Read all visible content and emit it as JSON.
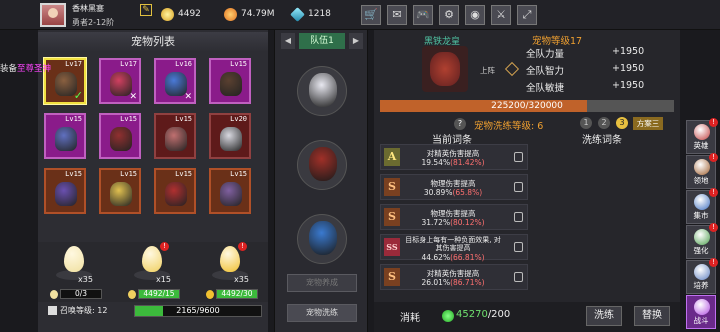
{
  "player": {
    "name": "香林黑塞",
    "rank": "勇者2-12阶"
  },
  "resources": {
    "gold": "4492",
    "food": "74.79M",
    "gem": "1218"
  },
  "toolbar": [
    {
      "name": "shop-icon",
      "glyph": "🛒"
    },
    {
      "name": "mail-icon",
      "glyph": "✉"
    },
    {
      "name": "gamepad-icon",
      "glyph": "🎮"
    },
    {
      "name": "settings-icon",
      "glyph": "⚙"
    },
    {
      "name": "color-wheel-icon",
      "glyph": "◉"
    },
    {
      "name": "sword-icon",
      "glyph": "⚔"
    },
    {
      "name": "expand-icon",
      "glyph": "⤢"
    }
  ],
  "pet_list": {
    "title": "宠物列表",
    "side_text_prefix": "装备",
    "side_text_highlight": "至尊圣神",
    "cards": [
      {
        "lv": "Lv17",
        "rarity": "orange",
        "color": "#8a6040",
        "selected": true,
        "mark": "check"
      },
      {
        "lv": "Lv17",
        "rarity": "purple",
        "color": "#d04060",
        "mark": "cross"
      },
      {
        "lv": "Lv16",
        "rarity": "purple",
        "color": "#4a7ad8",
        "mark": "cross"
      },
      {
        "lv": "Lv15",
        "rarity": "purple",
        "color": "#5a4030",
        "mark": ""
      },
      {
        "lv": "Lv15",
        "rarity": "purple",
        "color": "#6070c0",
        "mark": ""
      },
      {
        "lv": "Lv15",
        "rarity": "purple",
        "color": "#903030",
        "mark": ""
      },
      {
        "lv": "Lv15",
        "rarity": "red",
        "color": "#c07070",
        "mark": ""
      },
      {
        "lv": "Lv20",
        "rarity": "red",
        "color": "#d8d8e0",
        "mark": ""
      },
      {
        "lv": "Lv15",
        "rarity": "orange",
        "color": "#6a50b0",
        "mark": ""
      },
      {
        "lv": "Lv15",
        "rarity": "orange",
        "color": "#e0c050",
        "mark": ""
      },
      {
        "lv": "Lv15",
        "rarity": "orange",
        "color": "#b03030",
        "mark": ""
      },
      {
        "lv": "Lv15",
        "rarity": "orange",
        "color": "#8060a0",
        "mark": ""
      }
    ]
  },
  "eggs": [
    {
      "count": "x35",
      "progress": "0/3",
      "fill": 0.0,
      "color": "#f0e0a0"
    },
    {
      "count": "x15",
      "progress": "4492/15",
      "fill": 1.0,
      "color": "#f0d060"
    },
    {
      "count": "x35",
      "progress": "4492/30",
      "fill": 1.0,
      "color": "#f0c030"
    }
  ],
  "summon": {
    "label": "召唤等级: 12",
    "value": "2165/9600",
    "fill": 0.2255
  },
  "team": {
    "tab": "队伍1",
    "slots": [
      {
        "color": "#e8e8f0"
      },
      {
        "color": "#a03028"
      },
      {
        "color": "#3a7ad0"
      }
    ],
    "btn_equip": "宠物养成",
    "btn_wash": "宠物洗练"
  },
  "pet_info": {
    "name": "黑铁龙皇",
    "level": "宠物等级17",
    "onboard": "上阵",
    "buffs": [
      {
        "label": "全队力量",
        "value": "+1950"
      },
      {
        "label": "全队智力",
        "value": "+1950"
      },
      {
        "label": "全队敏捷",
        "value": "+1950"
      }
    ],
    "exp": "225200/320000",
    "exp_fill": 0.70375,
    "wash_level": "宠物洗练等级: 6",
    "plans": [
      "1",
      "2",
      "3"
    ],
    "active_plan": 2,
    "plan_name": "方案三",
    "col_current": "当前词条",
    "col_wash": "洗练词条",
    "affixes": [
      {
        "grade": "A",
        "cls": "a",
        "title": "对精英伤害提高",
        "value": "19.54%",
        "pct": "(81.42%)"
      },
      {
        "grade": "S",
        "cls": "s",
        "title": "物理伤害提高",
        "value": "30.89%",
        "pct": "(65.8%)"
      },
      {
        "grade": "S",
        "cls": "s",
        "title": "物理伤害提高",
        "value": "31.72%",
        "pct": "(80.12%)"
      },
      {
        "grade": "SS",
        "cls": "ss",
        "title": "目标身上每有一种负面效果, 对其伤害提高",
        "value": "44.62%",
        "pct": "(66.81%)",
        "multi": true
      },
      {
        "grade": "S",
        "cls": "s",
        "title": "对精英伤害提高",
        "value": "26.01%",
        "pct": "(86.71%)"
      }
    ],
    "consume_label": "消耗",
    "consume_current": "45270",
    "consume_total": "/200",
    "btn_wash": "洗练",
    "btn_replace": "替换"
  },
  "sidebar": [
    {
      "name": "heroes",
      "label": "英雄",
      "color": "#c04040"
    },
    {
      "name": "territory",
      "label": "领地",
      "color": "#a06030"
    },
    {
      "name": "market",
      "label": "集市",
      "color": "#4070c0"
    },
    {
      "name": "enhance",
      "label": "强化",
      "color": "#50a050"
    },
    {
      "name": "cultivate",
      "label": "培养",
      "color": "#6080c0"
    },
    {
      "name": "battle",
      "label": "战斗",
      "color": "#b050e0"
    }
  ]
}
